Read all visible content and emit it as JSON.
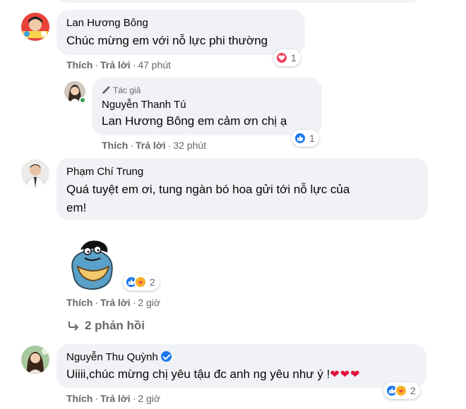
{
  "comments": [
    {
      "name": "Lan Hương Bông",
      "text": "Chúc mừng em với nỗ lực phi thường",
      "like_label": "Thích",
      "reply_label": "Trả lời",
      "time": "47 phút",
      "reaction_count": "1",
      "reaction_icon": "heart-icon"
    },
    {
      "author_badge": "Tác giả",
      "name": "Nguyễn Thanh Tú",
      "mention": "Lan Hương Bông",
      "text": " em cảm ơn chị ạ",
      "like_label": "Thích",
      "reply_label": "Trả lời",
      "time": "32 phút",
      "reaction_count": "1",
      "reaction_icon": "like-icon"
    },
    {
      "name": "Phạm Chí Trung",
      "text_line1": "Quá tuyệt em ơi, tung ngàn bó hoa gửi tới nỗ lực của",
      "text_line2": "em!",
      "sticker": "hug-sticker",
      "like_label": "Thích",
      "reply_label": "Trả lời",
      "time": "2 giờ",
      "reaction_count": "2",
      "reaction_icons": [
        "like-icon",
        "care-icon"
      ],
      "replies_label": "2 phản hồi"
    },
    {
      "name": "Nguyễn Thu Quỳnh",
      "verified": true,
      "text": "Uiiii,chúc mừng chị yêu tậu đc anh ng yêu như ý !",
      "emoji_hearts": "❤❤❤",
      "like_label": "Thích",
      "reply_label": "Trả lời",
      "time": "2 giờ",
      "reaction_count": "2",
      "reaction_icons": [
        "like-icon",
        "care-icon"
      ]
    }
  ],
  "colors": {
    "bubble": "#f0f2f5",
    "meta": "#65676b",
    "like": "#1877f2",
    "heart": "#f33e58",
    "care": "#f7b125"
  }
}
